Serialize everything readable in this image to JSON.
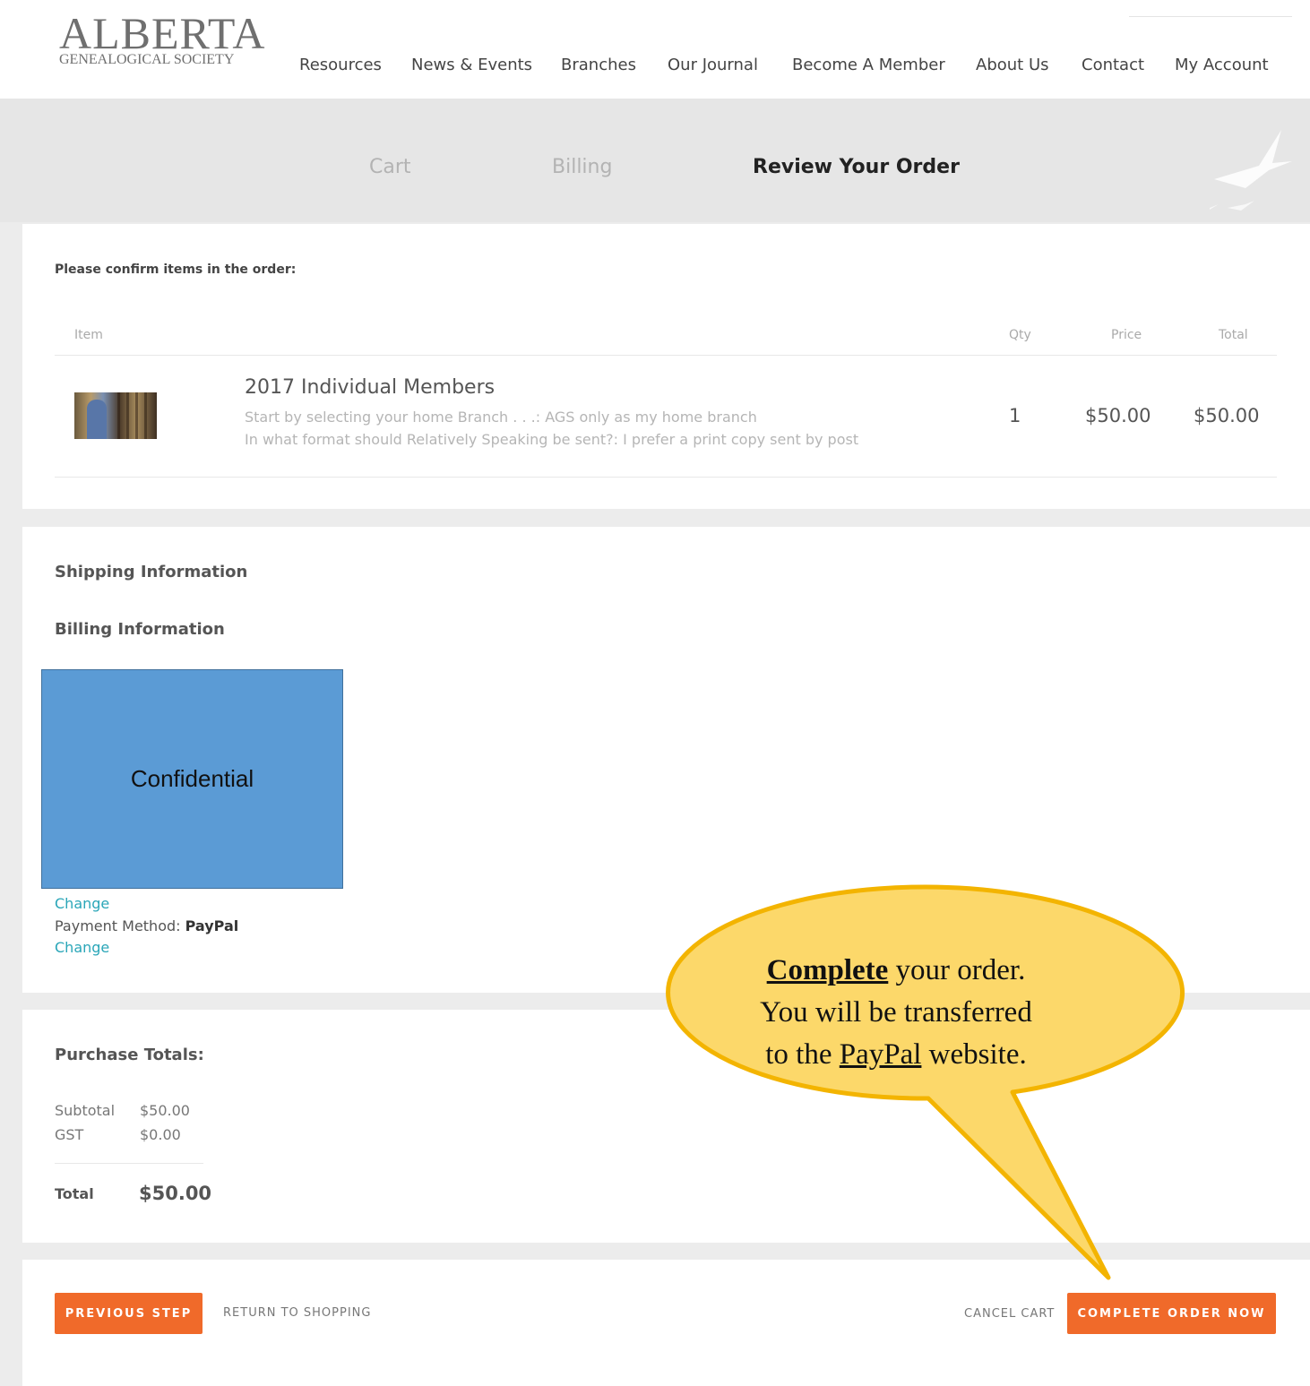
{
  "logo": {
    "title": "ALBERTA",
    "subtitle": "GENEALOGICAL SOCIETY"
  },
  "nav": [
    "Resources",
    "News & Events",
    "Branches",
    "Our Journal",
    "Become A Member",
    "About Us",
    "Contact",
    "My Account"
  ],
  "steps": [
    "Cart",
    "Billing",
    "Review Your Order"
  ],
  "order": {
    "heading": "Please confirm items in the order:",
    "columns": {
      "item": "Item",
      "qty": "Qty",
      "price": "Price",
      "total": "Total"
    },
    "item": {
      "name": "2017 Individual Members",
      "option1": "Start by selecting your home Branch . . .: AGS only as my home branch",
      "option2": "In what format should Relatively Speaking be sent?: I prefer a print copy sent by post",
      "qty": "1",
      "price": "$50.00",
      "total": "$50.00"
    }
  },
  "info": {
    "shipping_title": "Shipping Information",
    "billing_title": "Billing Information",
    "confidential": "Confidential",
    "change1": "Change",
    "payment_label": "Payment Method:",
    "payment_value": "PayPal",
    "change2": "Change"
  },
  "totals": {
    "title": "Purchase Totals:",
    "subtotal_label": "Subtotal",
    "subtotal_value": "$50.00",
    "gst_label": "GST",
    "gst_value": "$0.00",
    "total_label": "Total",
    "total_value": "$50.00"
  },
  "actions": {
    "previous": "PREVIOUS STEP",
    "return": "RETURN TO SHOPPING",
    "cancel": "CANCEL CART",
    "complete": "COMPLETE ORDER NOW"
  },
  "callout": {
    "word1": "Complete",
    "line1_rest": " your order.",
    "line2": "You will be transferred",
    "line3_pre": "to the ",
    "line3_link": "PayPal",
    "line3_post": " website."
  }
}
